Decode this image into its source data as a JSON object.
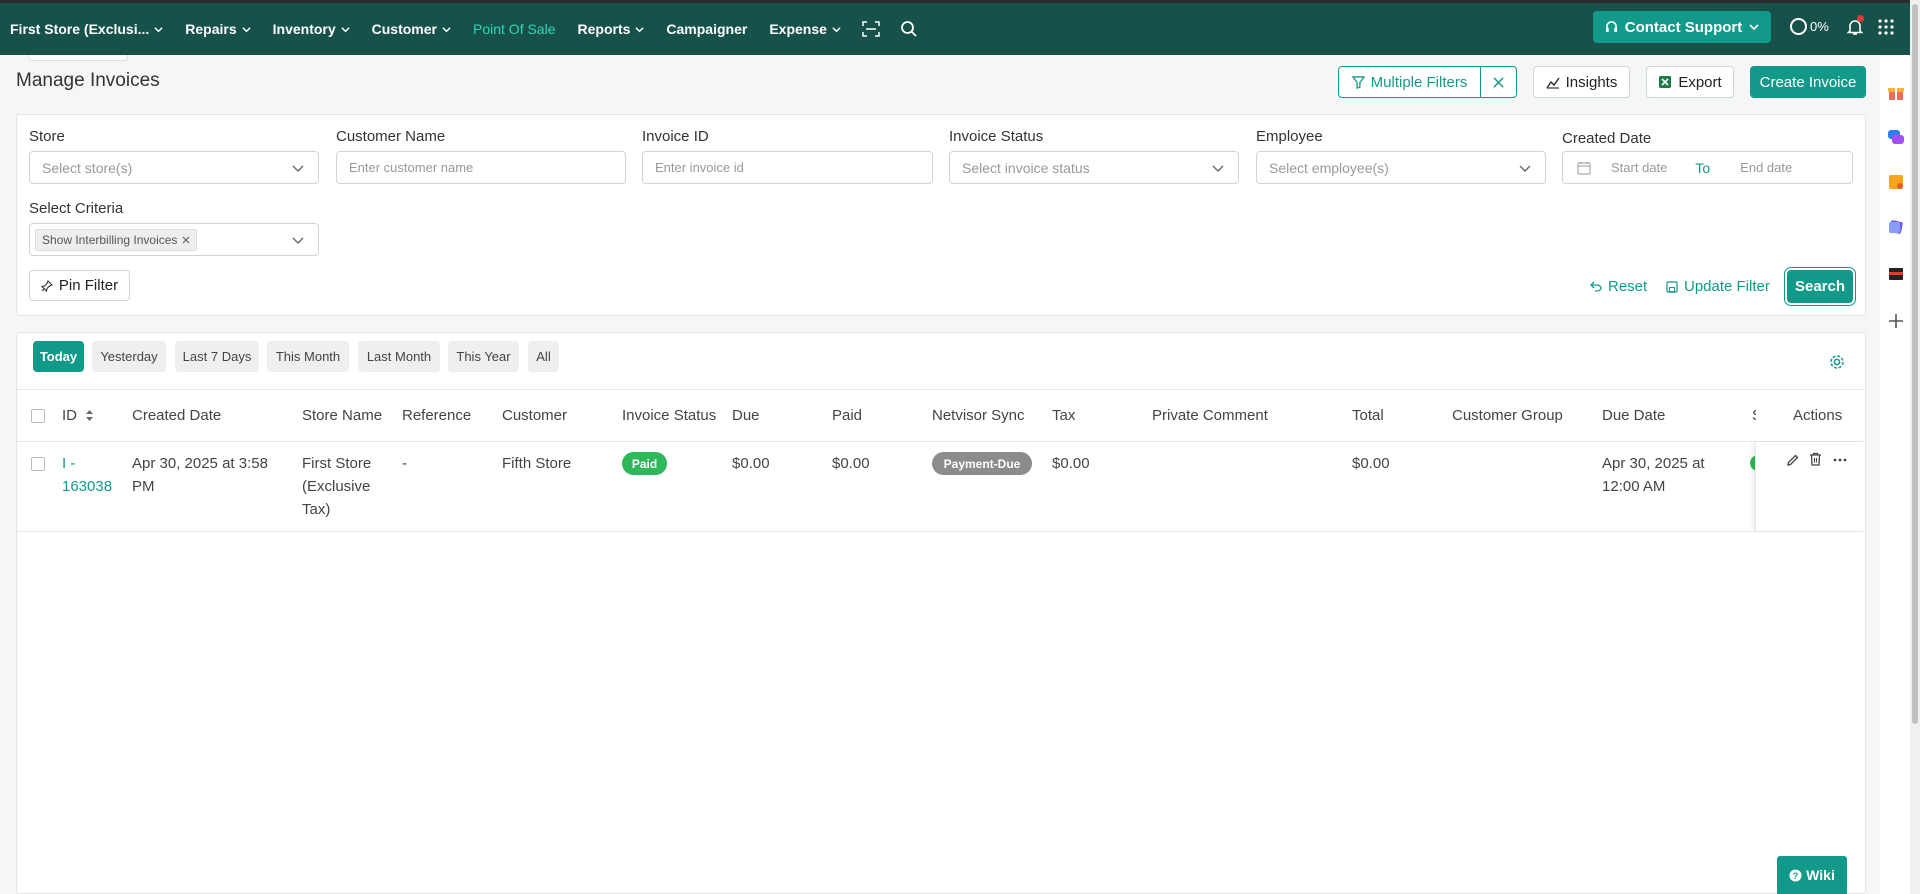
{
  "nav": {
    "store_label": "First Store (Exclusi...",
    "items": [
      {
        "label": "Repairs"
      },
      {
        "label": "Inventory"
      },
      {
        "label": "Customer"
      },
      {
        "label": "Point Of Sale"
      },
      {
        "label": "Reports"
      },
      {
        "label": "Campaigner"
      },
      {
        "label": "Expense"
      }
    ],
    "support_label": "Contact Support",
    "progress_label": "0%",
    "active_color": "#35d3b7",
    "bg_color": "#16524a"
  },
  "header": {
    "title": "Manage Invoices",
    "multiple_filters_label": "Multiple Filters",
    "insights_label": "Insights",
    "export_label": "Export",
    "create_label": "Create Invoice"
  },
  "filters": {
    "store": {
      "label": "Store",
      "placeholder": "Select store(s)"
    },
    "customer_name": {
      "label": "Customer Name",
      "placeholder": "Enter customer name"
    },
    "invoice_id": {
      "label": "Invoice ID",
      "placeholder": "Enter invoice id"
    },
    "invoice_status": {
      "label": "Invoice Status",
      "placeholder": "Select invoice status"
    },
    "employee": {
      "label": "Employee",
      "placeholder": "Select employee(s)"
    },
    "created_date": {
      "label": "Created Date",
      "start_placeholder": "Start date",
      "to_label": "To",
      "end_placeholder": "End date"
    },
    "criteria": {
      "label": "Select Criteria",
      "chip": "Show Interbilling Invoices"
    },
    "pin_label": "Pin Filter",
    "reset_label": "Reset",
    "update_label": "Update Filter",
    "search_label": "Search"
  },
  "periods": [
    "Today",
    "Yesterday",
    "Last 7 Days",
    "This Month",
    "Last Month",
    "This Year",
    "All"
  ],
  "table": {
    "columns": [
      "ID",
      "Created Date",
      "Store Name",
      "Reference",
      "Customer",
      "Invoice Status",
      "Due",
      "Paid",
      "Netvisor Sync",
      "Tax",
      "Private Comment",
      "Total",
      "Customer Group",
      "Due Date",
      "S",
      "Actions"
    ],
    "rows": [
      {
        "id_line1": "I -",
        "id_line2": "163038",
        "created_line1": "Apr 30, 2025 at 3:58",
        "created_line2": "PM",
        "store_line1": "First Store",
        "store_line2": "(Exclusive",
        "store_line3": "Tax)",
        "reference": "-",
        "customer": "Fifth Store",
        "status": "Paid",
        "due": "$0.00",
        "paid": "$0.00",
        "netvisor": "Payment-Due",
        "tax": "$0.00",
        "private_comment": "",
        "total": "$0.00",
        "customer_group": "",
        "due_date_line1": "Apr 30, 2025 at",
        "due_date_line2": "12:00 AM"
      }
    ]
  },
  "wiki_label": "Wiki",
  "colors": {
    "accent": "#13998a",
    "paid": "#2fb85a",
    "payment_due": "#8c8c8c"
  }
}
